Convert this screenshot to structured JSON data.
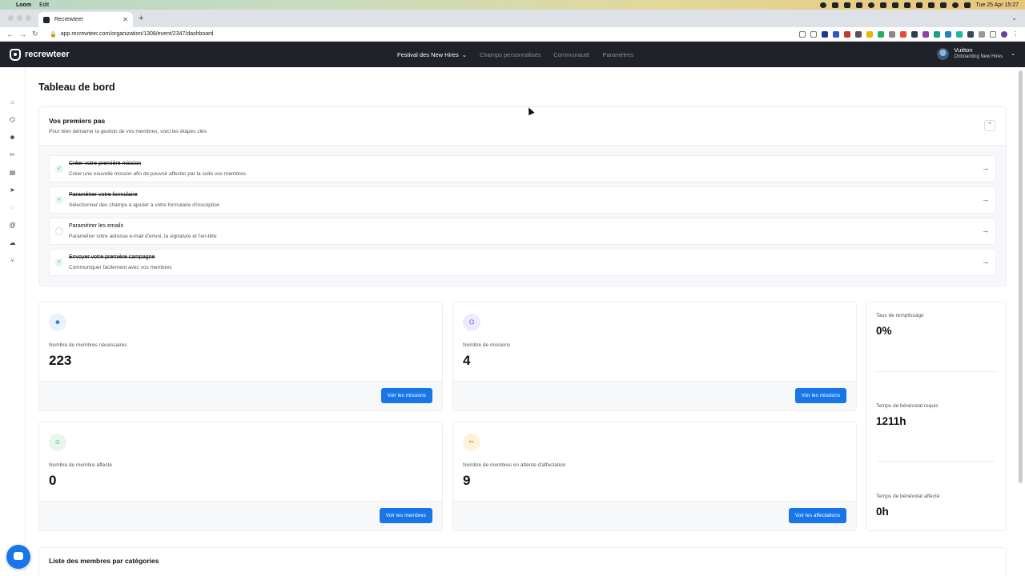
{
  "menubar": {
    "app": "Loom",
    "menu": "Edit",
    "datetime": "Tue 25 Apr  15:27"
  },
  "browser": {
    "tab_title": "Recrewteer",
    "url": "app.recrewteer.com/organization/1308/event/2347/dashboard"
  },
  "header": {
    "brand": "recrewteer",
    "nav_active": "Festival des New Hires",
    "nav_items": [
      "Champs personnalisés",
      "Communauté",
      "Paramètres"
    ],
    "user_name": "Vuitton",
    "user_subtitle": "Onboarding New Hires"
  },
  "sidebar": {
    "icons": [
      "home-icon",
      "sitemap-icon",
      "users-icon",
      "tools-icon",
      "document-icon",
      "send-icon",
      "check-circle-icon",
      "at-icon",
      "cloud-icon",
      "branch-icon"
    ]
  },
  "page": {
    "title": "Tableau de bord"
  },
  "steps": {
    "title": "Vos premiers pas",
    "subtitle": "Pour bien démarrer la gestion de vos membres, voici les étapes clés",
    "items": [
      {
        "title": "Créer votre première mission",
        "desc": "Créer une nouvelle mission afin de pouvoir affecter par la suite vos membres",
        "done": true
      },
      {
        "title": "Paramétrer votre formulaire",
        "desc": "Sélectionner des champs à ajouter à votre formulaire d'inscription",
        "done": true
      },
      {
        "title": "Paramétrer les emails",
        "desc": "Paramétrer votre adresse e-mail d'envoi, la signature et l'en-tête",
        "done": false
      },
      {
        "title": "Envoyer votre première campagne",
        "desc": "Communiquer facilement avec vos membres",
        "done": true
      }
    ]
  },
  "stats": [
    {
      "label": "Nombre de membres nécessaires",
      "value": "223",
      "button": "Voir les missions"
    },
    {
      "label": "Nombre de missions",
      "value": "4",
      "button": "Voir les missions"
    },
    {
      "label": "Nombre de membre affecté",
      "value": "0",
      "button": "Voir les membres"
    },
    {
      "label": "Nombre de membres en attente d'affectation",
      "value": "9",
      "button": "Voir les affectations"
    }
  ],
  "side_stats": [
    {
      "label": "Taux de remplissage",
      "value": "0%"
    },
    {
      "label": "Temps de bénévolat requis",
      "value": "1211h"
    },
    {
      "label": "Temps de bénévolat affecté",
      "value": "0h"
    }
  ],
  "bottom": {
    "title": "Liste des membres par catégories"
  },
  "colors": {
    "header_bg": "#1f2229",
    "primary": "#1876e8",
    "done_green": "#22a35a"
  }
}
